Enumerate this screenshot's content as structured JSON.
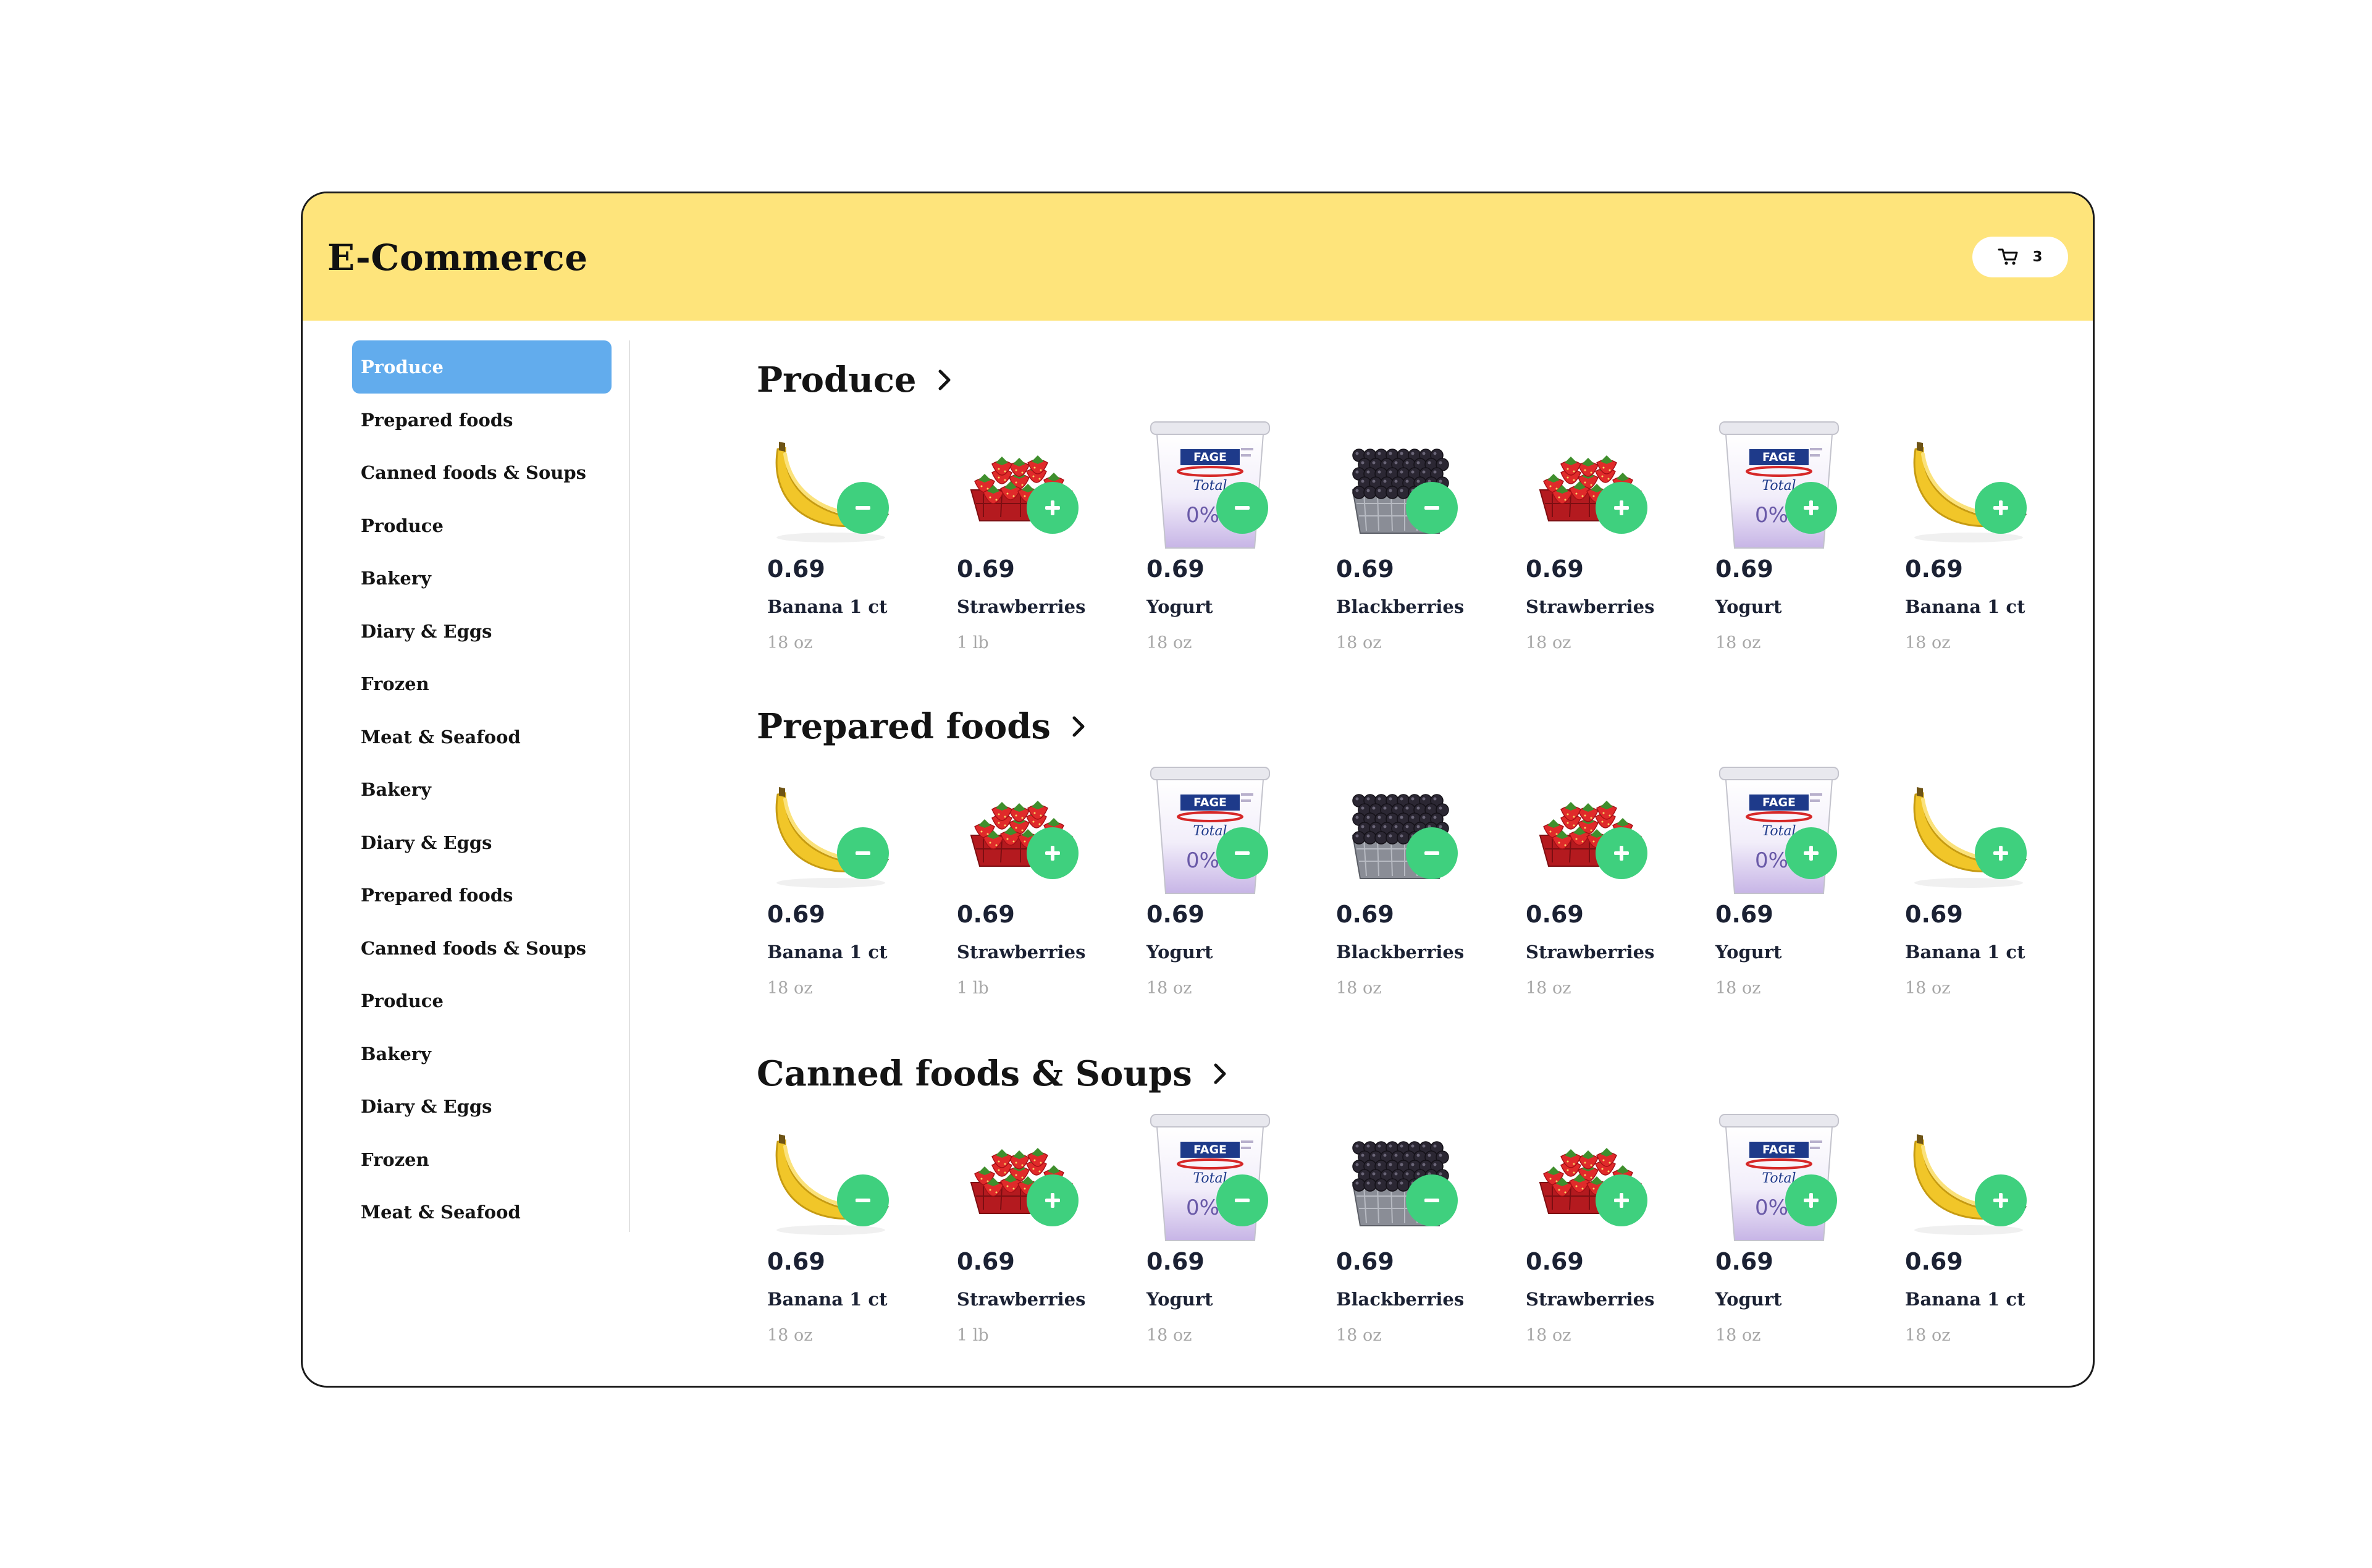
{
  "app": {
    "title": "E-Commerce"
  },
  "cart": {
    "icon": "cart-icon",
    "count": "3"
  },
  "colors": {
    "header": "#fee47b",
    "active_item": "#62aced",
    "quantity_button": "#3fd07e",
    "muted_text": "#a7a7a7"
  },
  "sidebar": {
    "items": [
      {
        "label": "Produce",
        "active": true
      },
      {
        "label": "Prepared foods"
      },
      {
        "label": "Canned foods & Soups"
      },
      {
        "label": "Produce"
      },
      {
        "label": "Bakery"
      },
      {
        "label": "Diary & Eggs"
      },
      {
        "label": "Frozen"
      },
      {
        "label": "Meat & Seafood"
      },
      {
        "label": "Bakery"
      },
      {
        "label": "Diary & Eggs"
      },
      {
        "label": "Prepared foods"
      },
      {
        "label": "Canned foods & Soups"
      },
      {
        "label": "Produce"
      },
      {
        "label": "Bakery"
      },
      {
        "label": "Diary & Eggs"
      },
      {
        "label": "Frozen"
      },
      {
        "label": "Meat & Seafood"
      }
    ]
  },
  "sections": [
    {
      "title": "Produce",
      "products": [
        {
          "image": "banana",
          "price": "0.69",
          "name": "Banana 1 ct",
          "size": "18 oz",
          "action": "minus"
        },
        {
          "image": "strawberries",
          "price": "0.69",
          "name": "Strawberries",
          "size": "1 lb",
          "action": "plus"
        },
        {
          "image": "yogurt",
          "price": "0.69",
          "name": "Yogurt",
          "size": "18 oz",
          "action": "minus"
        },
        {
          "image": "blackberries",
          "price": "0.69",
          "name": "Blackberries",
          "size": "18 oz",
          "action": "minus"
        },
        {
          "image": "strawberries",
          "price": "0.69",
          "name": "Strawberries",
          "size": "18 oz",
          "action": "plus"
        },
        {
          "image": "yogurt",
          "price": "0.69",
          "name": "Yogurt",
          "size": "18 oz",
          "action": "plus"
        },
        {
          "image": "banana",
          "price": "0.69",
          "name": "Banana 1 ct",
          "size": "18 oz",
          "action": "plus"
        }
      ]
    },
    {
      "title": "Prepared foods",
      "products": [
        {
          "image": "banana",
          "price": "0.69",
          "name": "Banana 1 ct",
          "size": "18 oz",
          "action": "minus"
        },
        {
          "image": "strawberries",
          "price": "0.69",
          "name": "Strawberries",
          "size": "1 lb",
          "action": "plus"
        },
        {
          "image": "yogurt",
          "price": "0.69",
          "name": "Yogurt",
          "size": "18 oz",
          "action": "minus"
        },
        {
          "image": "blackberries",
          "price": "0.69",
          "name": "Blackberries",
          "size": "18 oz",
          "action": "minus"
        },
        {
          "image": "strawberries",
          "price": "0.69",
          "name": "Strawberries",
          "size": "18 oz",
          "action": "plus"
        },
        {
          "image": "yogurt",
          "price": "0.69",
          "name": "Yogurt",
          "size": "18 oz",
          "action": "plus"
        },
        {
          "image": "banana",
          "price": "0.69",
          "name": "Banana 1 ct",
          "size": "18 oz",
          "action": "plus"
        }
      ]
    },
    {
      "title": "Canned foods & Soups",
      "products": [
        {
          "image": "banana",
          "price": "0.69",
          "name": "Banana 1 ct",
          "size": "18 oz",
          "action": "minus"
        },
        {
          "image": "strawberries",
          "price": "0.69",
          "name": "Strawberries",
          "size": "1 lb",
          "action": "plus"
        },
        {
          "image": "yogurt",
          "price": "0.69",
          "name": "Yogurt",
          "size": "18 oz",
          "action": "minus"
        },
        {
          "image": "blackberries",
          "price": "0.69",
          "name": "Blackberries",
          "size": "18 oz",
          "action": "minus"
        },
        {
          "image": "strawberries",
          "price": "0.69",
          "name": "Strawberries",
          "size": "18 oz",
          "action": "plus"
        },
        {
          "image": "yogurt",
          "price": "0.69",
          "name": "Yogurt",
          "size": "18 oz",
          "action": "plus"
        },
        {
          "image": "banana",
          "price": "0.69",
          "name": "Banana 1 ct",
          "size": "18 oz",
          "action": "plus"
        }
      ]
    }
  ],
  "yogurt_label": {
    "brand": "FAGE",
    "variant": "Total",
    "fat": "0%"
  }
}
